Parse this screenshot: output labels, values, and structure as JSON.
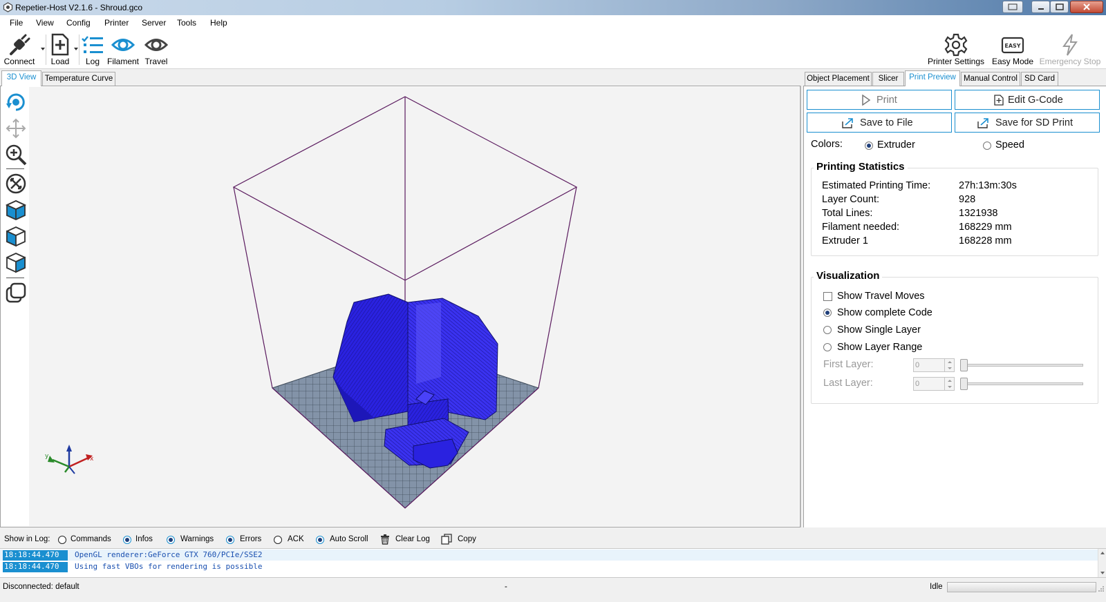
{
  "window": {
    "title": "Repetier-Host V2.1.6 - Shroud.gco"
  },
  "menu": [
    "File",
    "View",
    "Config",
    "Printer",
    "Server",
    "Tools",
    "Help"
  ],
  "toolbar": {
    "connect": "Connect",
    "load": "Load",
    "log": "Log",
    "filament": "Filament",
    "travel": "Travel",
    "printer_settings": "Printer Settings",
    "easy_mode": "Easy Mode",
    "easy_badge": "EASY",
    "emergency_stop": "Emergency Stop"
  },
  "left_tabs": [
    "3D View",
    "Temperature Curve"
  ],
  "right_tabs": [
    "Object Placement",
    "Slicer",
    "Print Preview",
    "Manual Control",
    "SD Card"
  ],
  "preview": {
    "print": "Print",
    "edit_gcode": "Edit G-Code",
    "save_to_file": "Save to File",
    "save_sd": "Save for SD Print",
    "colors_label": "Colors:",
    "color_extruder": "Extruder",
    "color_speed": "Speed",
    "stats_title": "Printing Statistics",
    "stats": [
      {
        "label": "Estimated Printing Time:",
        "value": "27h:13m:30s"
      },
      {
        "label": "Layer Count:",
        "value": "928"
      },
      {
        "label": "Total Lines:",
        "value": "1321938"
      },
      {
        "label": "Filament needed:",
        "value": "168229 mm"
      },
      {
        "label": "Extruder 1",
        "value": "168228 mm"
      }
    ],
    "viz_title": "Visualization",
    "show_travel": "Show Travel Moves",
    "show_complete": "Show complete Code",
    "show_single": "Show Single Layer",
    "show_range": "Show Layer Range",
    "first_layer": "First Layer:",
    "first_layer_value": "0",
    "last_layer": "Last Layer:",
    "last_layer_value": "0"
  },
  "log": {
    "show_in_log": "Show in Log:",
    "commands": "Commands",
    "infos": "Infos",
    "warnings": "Warnings",
    "errors": "Errors",
    "ack": "ACK",
    "auto_scroll": "Auto Scroll",
    "clear_log": "Clear Log",
    "copy": "Copy",
    "lines": [
      {
        "time": "18:18:44.470",
        "msg": "OpenGL renderer:GeForce GTX 760/PCIe/SSE2"
      },
      {
        "time": "18:18:44.470",
        "msg": "Using fast VBOs for rendering is possible"
      }
    ]
  },
  "status": {
    "left": "Disconnected: default",
    "middle": "-",
    "right": "Idle"
  },
  "colors": {
    "accent": "#1a8fd0",
    "model": "#2a22e0",
    "bed": "#7d8da1",
    "box": "#5a1a5e"
  }
}
